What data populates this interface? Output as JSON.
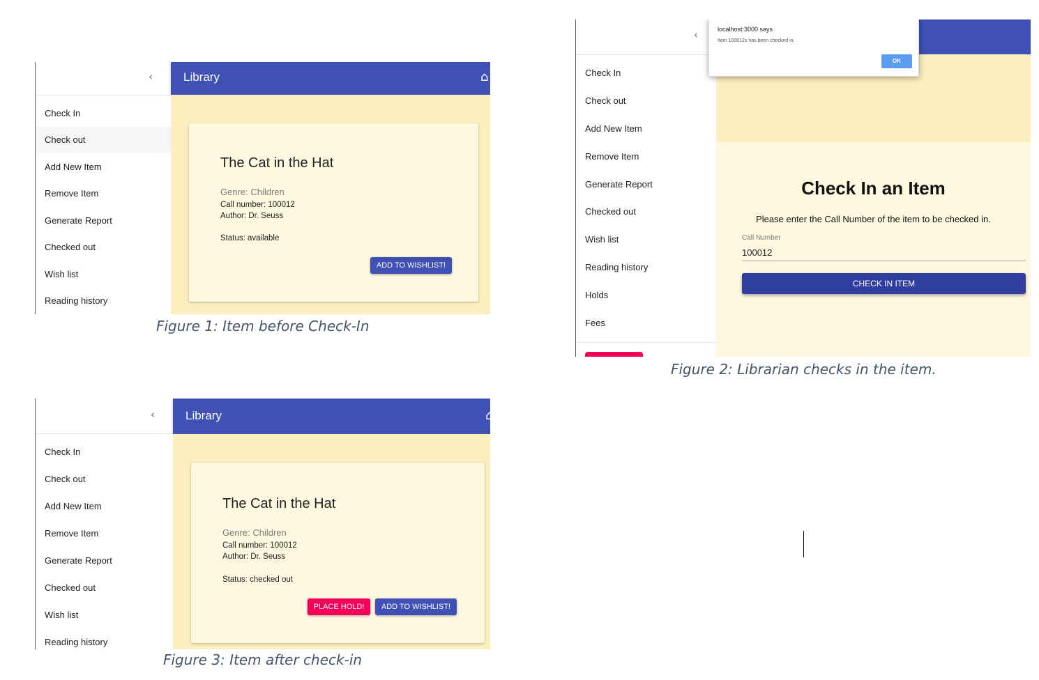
{
  "nav_items": [
    "Check In",
    "Check out",
    "Add New Item",
    "Remove Item",
    "Generate Report",
    "Checked out",
    "Wish list",
    "Reading history",
    "Holds",
    "Fees"
  ],
  "icons": {
    "collapse": "chevron-left-icon",
    "home": "home-icon"
  },
  "colors": {
    "app_bar": "#3f51b5",
    "content_bg": "#fcefbd",
    "card_bg": "#fef8e1",
    "primary_button": "#3f51b5",
    "secondary_button": "#f50057",
    "caption_text": "#44546a"
  },
  "figure1": {
    "app_title": "Library",
    "book": {
      "title": "The Cat in the Hat",
      "genre": "Genre: Children",
      "call_number": "Call number: 100012",
      "author": "Author: Dr. Seuss",
      "status": "Status: available"
    },
    "wishlist_button": "ADD TO WISHLIST!",
    "caption": "Figure 1: Item before Check-In"
  },
  "figure2": {
    "dialog": {
      "origin": "localhost:3000 says",
      "message": "Item 100012s has been checked in.",
      "ok_label": "OK"
    },
    "heading": "Check In an Item",
    "instruction": "Please enter the Call Number of the item to be checked in.",
    "field_label": "Call Number",
    "field_value": "100012",
    "submit_label": "CHECK IN ITEM",
    "caption": "Figure 2: Librarian checks in the item."
  },
  "figure3": {
    "app_title": "Library",
    "book": {
      "title": "The Cat in the Hat",
      "genre": "Genre: Children",
      "call_number": "Call number: 100012",
      "author": "Author: Dr. Seuss",
      "status": "Status: checked out"
    },
    "hold_button": "PLACE HOLD!",
    "wishlist_button": "ADD TO WISHLIST!",
    "caption": "Figure 3: Item after check-in"
  }
}
